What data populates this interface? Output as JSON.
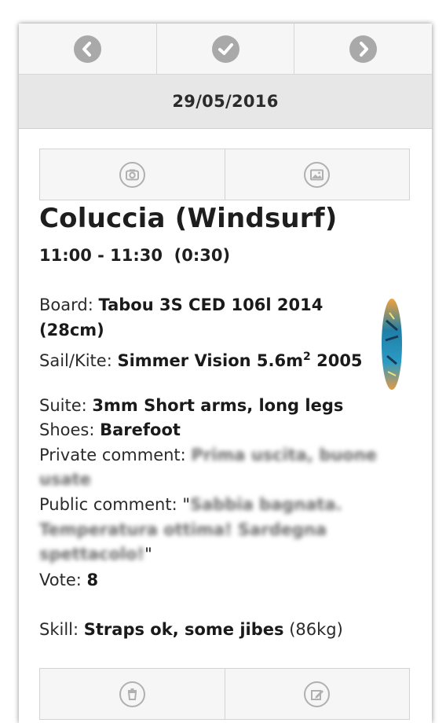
{
  "nav": {
    "prev_icon": "chevron-left-icon",
    "confirm_icon": "check-icon",
    "next_icon": "chevron-right-icon"
  },
  "date": "29/05/2016",
  "media": {
    "camera_icon": "camera-icon",
    "gallery_icon": "image-icon"
  },
  "session": {
    "title": "Coluccia (Windsurf)",
    "time_range": "11:00 - 11:30",
    "duration": "(0:30)"
  },
  "details": {
    "board_label": "Board:",
    "board_value_line1": "Tabou 3S CED 106l 2014",
    "board_value_line2": "(28cm)",
    "sail_label": "Sail/Kite:",
    "sail_value_prefix": "Simmer Vision 5.6m",
    "sail_value_sup": "2",
    "sail_value_suffix": " 2005",
    "suite_label": "Suite:",
    "suite_value": "3mm Short arms, long legs",
    "shoes_label": "Shoes:",
    "shoes_value": "Barefoot",
    "private_label": "Private comment:",
    "private_value_line1": "Prima uscita, buone",
    "private_value_line2": "usate",
    "public_label": "Public comment: \"",
    "public_value_line1": "Sabbia bagnata.",
    "public_value_line2": "Temperatura ottima! Sardegna",
    "public_value_line3": "spettacolo!",
    "public_close": "\"",
    "vote_label": "Vote:",
    "vote_value": "8",
    "skill_label": "Skill:",
    "skill_value": "Straps ok, some jibes",
    "skill_weight": "(86kg)"
  },
  "actions": {
    "delete_icon": "trash-icon",
    "edit_icon": "edit-icon"
  },
  "colors": {
    "icon_grey": "#a9a9a9",
    "header_bg": "#e7e7e7",
    "button_bg": "#f6f6f6"
  }
}
